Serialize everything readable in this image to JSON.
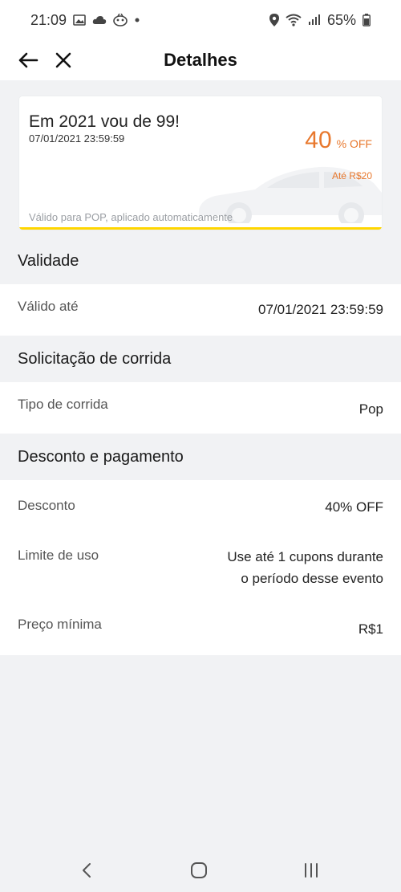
{
  "status": {
    "time": "21:09",
    "battery": "65%",
    "left_icons": [
      "image-icon",
      "cloud-icon",
      "face-icon",
      "dot-icon"
    ],
    "right_icons": [
      "location-icon",
      "wifi-icon",
      "signal-icon",
      "battery-icon"
    ]
  },
  "appbar": {
    "title": "Detalhes"
  },
  "coupon": {
    "title": "Em 2021 vou de 99!",
    "date": "07/01/2021 23:59:59",
    "discount_value": "40",
    "discount_unit": "% OFF",
    "cap": "Até R$20",
    "note": "Válido para POP, aplicado automaticamente",
    "accent_color": "#e8782d",
    "bar_color": "#ffd600"
  },
  "sections": {
    "validity": {
      "heading": "Validade",
      "rows": [
        {
          "label": "Válido até",
          "value": "07/01/2021 23:59:59"
        }
      ]
    },
    "ride": {
      "heading": "Solicitação de corrida",
      "rows": [
        {
          "label": "Tipo de corrida",
          "value": "Pop"
        }
      ]
    },
    "payment": {
      "heading": "Desconto e pagamento",
      "rows": [
        {
          "label": "Desconto",
          "value": "40% OFF"
        },
        {
          "label": "Limite de uso",
          "value_line1": "Use até 1 cupons durante",
          "value_line2": "o período desse evento"
        },
        {
          "label": "Preço mínima",
          "value": "R$1"
        }
      ]
    }
  },
  "navbar": {
    "icons": [
      "back-nav-icon",
      "home-nav-icon",
      "recents-nav-icon"
    ]
  }
}
